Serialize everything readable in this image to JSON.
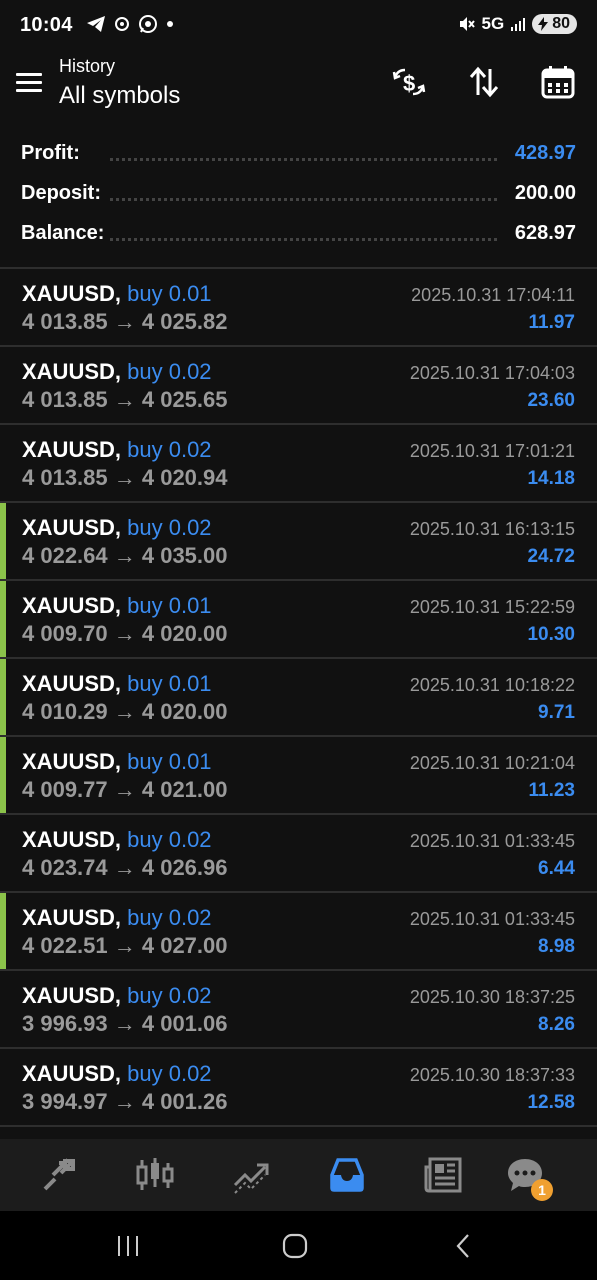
{
  "status_bar": {
    "time": "10:04",
    "network": "5G",
    "battery": "80"
  },
  "header": {
    "subtitle": "History",
    "title": "All symbols"
  },
  "summary": {
    "profit_label": "Profit:",
    "profit_value": "428.97",
    "deposit_label": "Deposit:",
    "deposit_value": "200.00",
    "balance_label": "Balance:",
    "balance_value": "628.97"
  },
  "trades": [
    {
      "symbol": "XAUUSD,",
      "type": "buy 0.01",
      "prices": "4 013.85 → 4 025.82",
      "time": "2025.10.31 17:04:11",
      "profit": "11.97"
    },
    {
      "symbol": "XAUUSD,",
      "type": "buy 0.02",
      "prices": "4 013.85 → 4 025.65",
      "time": "2025.10.31 17:04:03",
      "profit": "23.60"
    },
    {
      "symbol": "XAUUSD,",
      "type": "buy 0.02",
      "prices": "4 013.85 → 4 020.94",
      "time": "2025.10.31 17:01:21",
      "profit": "14.18"
    },
    {
      "symbol": "XAUUSD,",
      "type": "buy 0.02",
      "prices": "4 022.64 → 4 035.00",
      "time": "2025.10.31 16:13:15",
      "profit": "24.72"
    },
    {
      "symbol": "XAUUSD,",
      "type": "buy 0.01",
      "prices": "4 009.70 → 4 020.00",
      "time": "2025.10.31 15:22:59",
      "profit": "10.30"
    },
    {
      "symbol": "XAUUSD,",
      "type": "buy 0.01",
      "prices": "4 010.29 → 4 020.00",
      "time": "2025.10.31 10:18:22",
      "profit": "9.71"
    },
    {
      "symbol": "XAUUSD,",
      "type": "buy 0.01",
      "prices": "4 009.77 → 4 021.00",
      "time": "2025.10.31 10:21:04",
      "profit": "11.23"
    },
    {
      "symbol": "XAUUSD,",
      "type": "buy 0.02",
      "prices": "4 023.74 → 4 026.96",
      "time": "2025.10.31 01:33:45",
      "profit": "6.44"
    },
    {
      "symbol": "XAUUSD,",
      "type": "buy 0.02",
      "prices": "4 022.51 → 4 027.00",
      "time": "2025.10.31 01:33:45",
      "profit": "8.98"
    },
    {
      "symbol": "XAUUSD,",
      "type": "buy 0.02",
      "prices": "3 996.93 → 4 001.06",
      "time": "2025.10.30 18:37:25",
      "profit": "8.26"
    },
    {
      "symbol": "XAUUSD,",
      "type": "buy 0.02",
      "prices": "3 994.97 → 4 001.26",
      "time": "2025.10.30 18:37:33",
      "profit": "12.58"
    }
  ],
  "bottom_nav": {
    "chat_badge": "1"
  },
  "colors": {
    "accent_blue": "#3b8cf0",
    "marker_green": "#8bc34a",
    "badge_orange": "#f0a030",
    "background": "#111111"
  },
  "icons": [
    "menu-icon",
    "currency-exchange-icon",
    "sort-icon",
    "calendar-icon",
    "quotes-icon",
    "chart-icon",
    "trade-icon",
    "history-icon",
    "news-icon",
    "chat-icon"
  ]
}
